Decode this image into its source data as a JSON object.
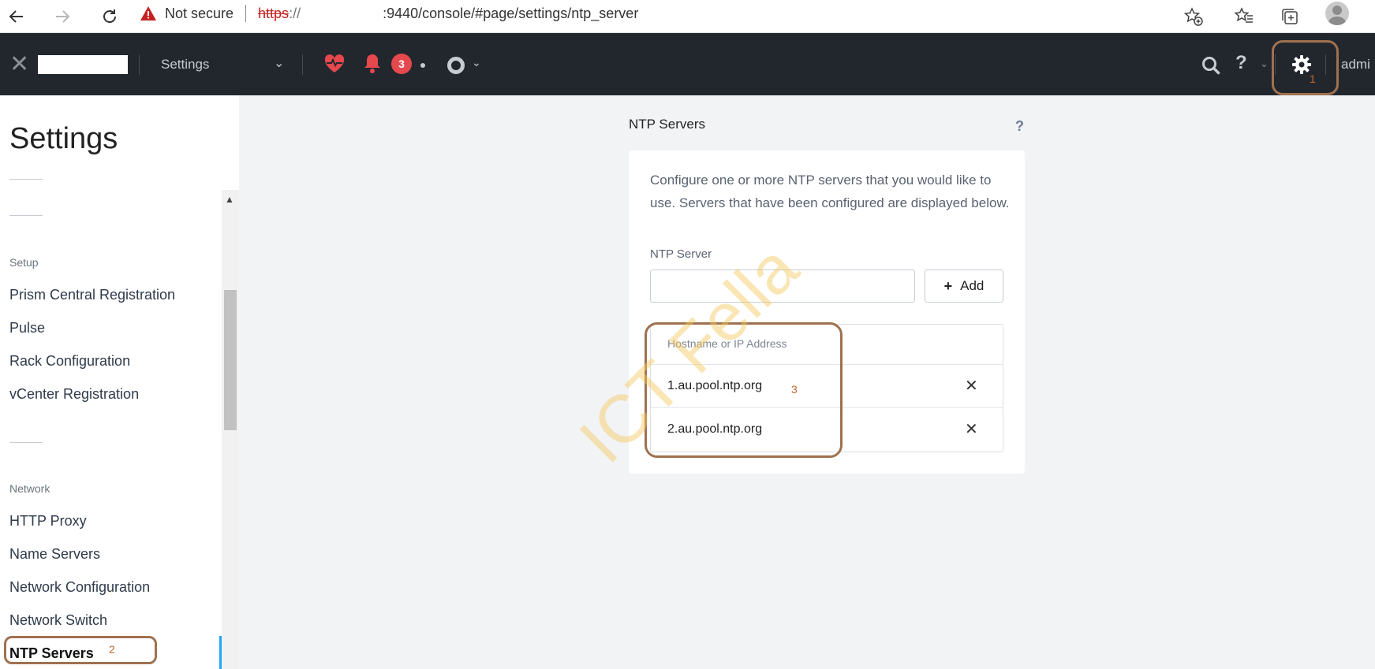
{
  "browser": {
    "security_label": "Not secure",
    "url_scheme": "https",
    "url_slashes": "://",
    "url_rest": ":9440/console/#page/settings/ntp_server",
    "icons": [
      "back-arrow-icon",
      "forward-arrow-icon",
      "reload-icon",
      "warning-icon",
      "add-favorite-icon",
      "favorites-icon",
      "collections-icon",
      "profile-avatar-icon"
    ]
  },
  "app_header": {
    "title": "Settings",
    "alert_count": "3",
    "user": "admi",
    "icons": [
      "nutanix-x-logo-icon",
      "chevron-down-icon",
      "health-heart-icon",
      "alert-bell-icon",
      "task-ring-icon",
      "search-icon",
      "help-icon",
      "gear-icon"
    ],
    "accent_color": "#e5484d"
  },
  "annotations": {
    "one": "1",
    "two": "2",
    "three": "3"
  },
  "sidebar": {
    "title": "Settings",
    "groups": [
      {
        "label": "Setup",
        "items": [
          "Prism Central Registration",
          "Pulse",
          "Rack Configuration",
          "vCenter Registration"
        ]
      },
      {
        "label": "Network",
        "items": [
          "HTTP Proxy",
          "Name Servers",
          "Network Configuration",
          "Network Switch",
          "NTP Servers"
        ]
      }
    ],
    "active_item": "NTP Servers"
  },
  "main": {
    "section_title": "NTP Servers",
    "help": "?",
    "description": "Configure one or more NTP servers that you would like to use. Servers that have been configured are displayed below.",
    "field_label": "NTP Server",
    "input_value": "",
    "add_label": "Add",
    "table": {
      "header": "Hostname or IP Address",
      "rows": [
        "1.au.pool.ntp.org",
        "2.au.pool.ntp.org"
      ]
    }
  },
  "watermark": "ICT Fella"
}
